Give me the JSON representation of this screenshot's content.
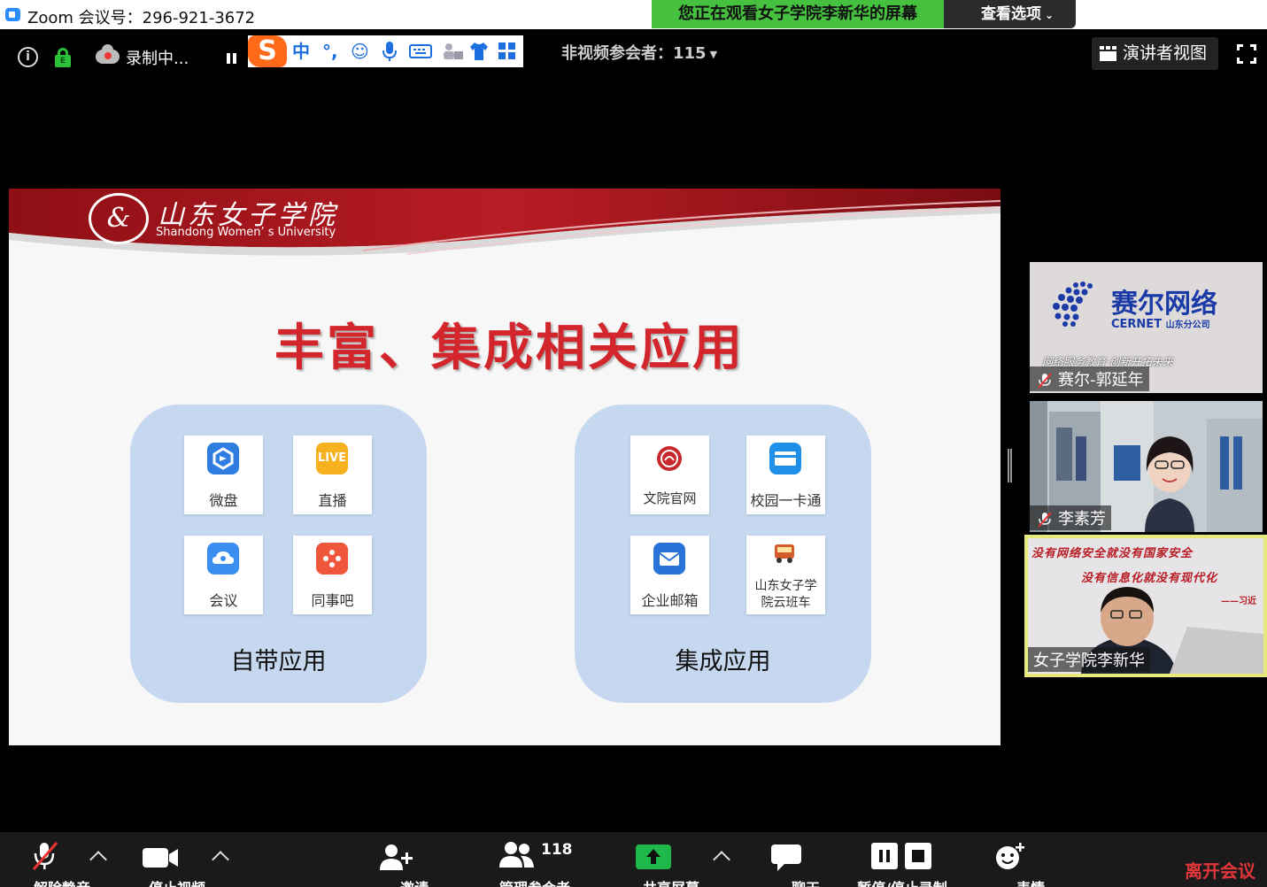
{
  "window": {
    "title": "Zoom 会议号：296-921-3672",
    "share_banner": "您正在观看女子学院李新华的屏幕",
    "view_options": "查看选项"
  },
  "top_overlay": {
    "recording_label": "录制中...",
    "non_video_label": "非视频参会者：115",
    "speaker_view_label": "演讲者视图"
  },
  "ime_toolbar": {
    "logo": "S",
    "items": [
      "中",
      "°,",
      "☺",
      "🎤",
      "⌨",
      "👥",
      "👕",
      "▦"
    ]
  },
  "slide": {
    "school_name_cn": "山东女子学院",
    "school_name_en": "Shandong Women’ s University",
    "seal_text": "&",
    "headline": "丰富、集成相关应用",
    "panels": [
      {
        "title": "自带应用",
        "tiles": [
          {
            "label": "微盘",
            "icon": "cloud-disk-icon",
            "color": "#2f7de1"
          },
          {
            "label": "直播",
            "icon": "live-icon",
            "icon_text": "LIVE",
            "color": "#f5b21e"
          },
          {
            "label": "会议",
            "icon": "meeting-icon",
            "color": "#3a8ef0"
          },
          {
            "label": "同事吧",
            "icon": "colleague-icon",
            "color": "#f0563b"
          }
        ]
      },
      {
        "title": "集成应用",
        "tiles": [
          {
            "label": "文院官网",
            "icon": "school-seal-icon",
            "color": "#c8282c"
          },
          {
            "label": "校园一卡通",
            "icon": "campus-card-icon",
            "color": "#1f8fe8"
          },
          {
            "label": "企业邮箱",
            "icon": "mail-icon",
            "color": "#2a73d6"
          },
          {
            "label": "山东女子学院云班车",
            "line1": "山东女子学",
            "line2": "院云班车",
            "icon": "bus-icon",
            "color": "#d45b2a"
          }
        ]
      }
    ]
  },
  "participants": [
    {
      "name": "赛尔-郭延年",
      "muted": true,
      "video_text": {
        "cn": "赛尔网络",
        "en": "CERNET",
        "en_sub": "山东分公司",
        "slogan": "网络服务教育·创新开拓未来"
      }
    },
    {
      "name": "李素芳",
      "muted": true
    },
    {
      "name": "女子学院李新华",
      "muted": false,
      "active": true,
      "video_text": {
        "line1": "没有网络安全就没有国家安全",
        "line2": "没有信息化就没有现代化",
        "line3": "——习近"
      }
    }
  ],
  "toolbar": {
    "unmute": "解除静音",
    "start_video": "停止视频",
    "invite": "邀请",
    "manage_participants": "管理参会者",
    "participant_count": "118",
    "share_screen": "共享屏幕",
    "chat": "聊天",
    "pause_recording": "暂停/停止录制",
    "reactions": "表情",
    "leave": "离开会议"
  },
  "colors": {
    "share_banner_bg": "#45c03f",
    "leave_red": "#e0363a",
    "share_green": "#1fb84a",
    "headline_red": "#d2262c",
    "panel_bg": "#c6d8ef",
    "active_speaker_border": "#e8e97b"
  }
}
